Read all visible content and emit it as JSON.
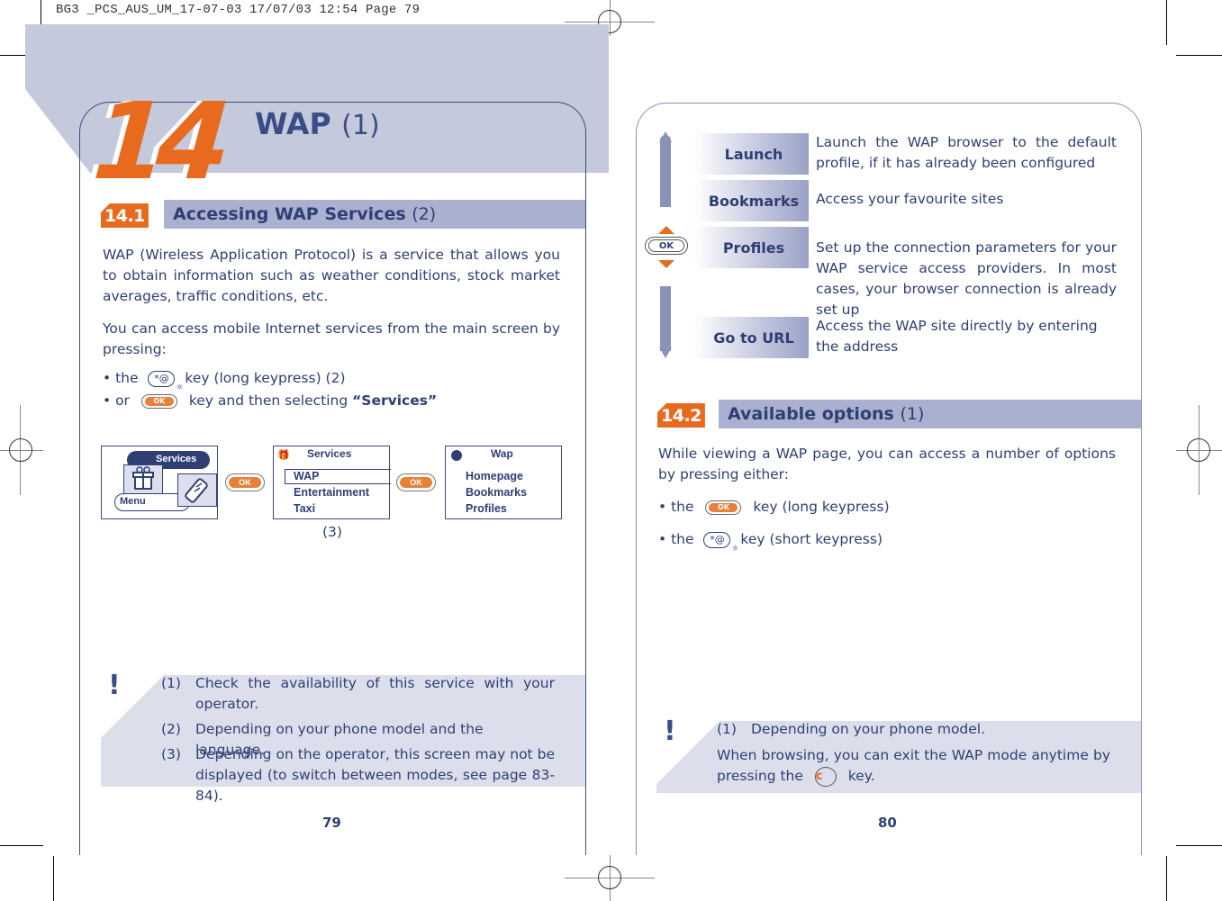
{
  "slug": "BG3 _PCS_AUS_UM_17-07-03  17/07/03  12:54  Page 79",
  "colors": {
    "accent_orange": "#e86a1f",
    "navy": "#2f3f73",
    "band": "#c4c9dc",
    "note_bg": "#dcdfeb",
    "section_bar": "#aab0cf"
  },
  "left_page": {
    "chapter_number": "14",
    "chapter_title": "WAP",
    "chapter_title_note": "(1)",
    "section": {
      "number": "14.1",
      "title": "Accessing WAP Services",
      "note": "(2)"
    },
    "paragraphs": [
      "WAP (Wireless Application Protocol) is a service that allows you to obtain information such as weather conditions, stock market averages, traffic conditions, etc.",
      "You can access mobile Internet services from the main screen by pressing:"
    ],
    "bullets": [
      {
        "prefix": "• the",
        "key": "*@",
        "suffix": "key (long keypress) (2)"
      },
      {
        "prefix": "• or",
        "key": "OK",
        "suffix": "key and then selecting",
        "bold": "“Services”"
      }
    ],
    "screens": [
      {
        "title": "Services",
        "footer": "Menu",
        "icons": [
          "gift-icon",
          "phone-icon"
        ]
      },
      {
        "title": "Services",
        "items": [
          "WAP",
          "Entertainment",
          "Taxi"
        ],
        "selected": "WAP",
        "icon": "gift-icon"
      },
      {
        "title": "Wap",
        "items": [
          "Homepage",
          "Bookmarks",
          "Profiles"
        ],
        "icon": "globe-icon"
      }
    ],
    "ok_label": "OK",
    "screen_note": "(3)",
    "notes": [
      {
        "num": "(1)",
        "text": "Check the availability of this service with your operator."
      },
      {
        "num": "(2)",
        "text": "Depending on your phone model and the language."
      },
      {
        "num": "(3)",
        "text": "Depending on the operator, this screen may not be displayed (to switch between modes, see page 83-84)."
      }
    ],
    "exclamation": "!",
    "page_number": "79"
  },
  "right_page": {
    "menu": [
      {
        "label": "Launch",
        "desc": "Launch the WAP browser to the default profile, if it has already been configured"
      },
      {
        "label": "Bookmarks",
        "desc": "Access your favourite sites"
      },
      {
        "label": "Profiles",
        "desc": "Set up the connection parameters for your WAP service access providers. In most cases, your browser connection is already set up"
      },
      {
        "label": "Go to URL",
        "desc": "Access the WAP site directly by entering the address"
      }
    ],
    "nav_ok_label": "OK",
    "section": {
      "number": "14.2",
      "title": "Available options",
      "note": "(1)"
    },
    "paragraph": "While viewing a WAP page, you can access a number of options by pressing either:",
    "bullets": [
      {
        "prefix": "• the",
        "key": "OK",
        "suffix": "key (long keypress)"
      },
      {
        "prefix": "• the",
        "key": "*@",
        "suffix": "key (short keypress)"
      }
    ],
    "notes": [
      {
        "num": "(1)",
        "text": "Depending on your phone model."
      }
    ],
    "note_extra_before": "When browsing, you can exit the WAP mode anytime by pressing the",
    "note_extra_key": "c",
    "note_extra_after": "key.",
    "exclamation": "!",
    "page_number": "80"
  }
}
